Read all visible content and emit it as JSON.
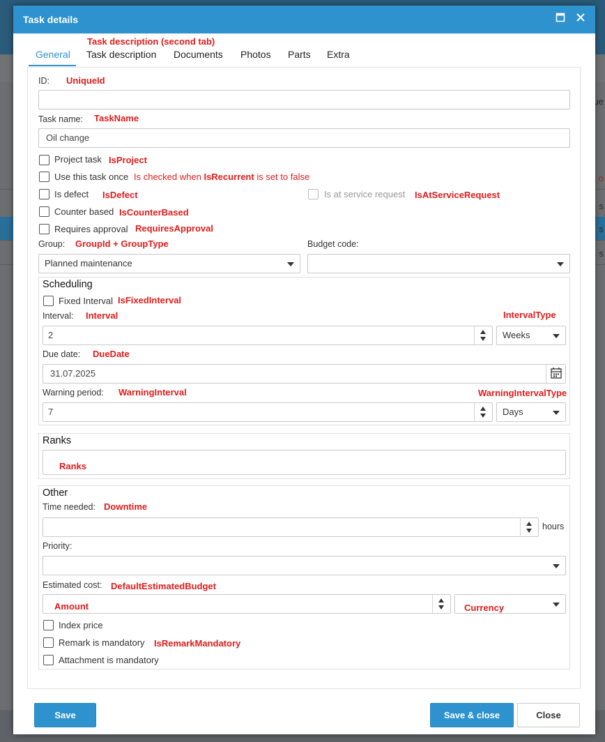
{
  "dialog": {
    "title": "Task details"
  },
  "tabs": [
    {
      "label": "General"
    },
    {
      "label": "Task description"
    },
    {
      "label": "Documents"
    },
    {
      "label": "Photos"
    },
    {
      "label": "Parts"
    },
    {
      "label": "Extra"
    }
  ],
  "annotations": {
    "task_description_tab": "Task description (second tab)",
    "unique_id": "UniqueId",
    "task_name": "TaskName",
    "is_project": "IsProject",
    "is_recurrent_pre": "Is checked when ",
    "is_recurrent_bold": "IsRecurrent",
    "is_recurrent_post": " is set to false",
    "is_defect": "IsDefect",
    "is_at_service_request": "IsAtServiceRequest",
    "is_counter_based": "IsCounterBased",
    "requires_approval": "RequiresApproval",
    "group": "GroupId + GroupType",
    "is_fixed_interval": "IsFixedInterval",
    "interval": "Interval",
    "interval_type": "IntervalType",
    "due_date": "DueDate",
    "warning_interval": "WarningInterval",
    "warning_interval_type": "WarningIntervalType",
    "ranks": "Ranks",
    "downtime": "Downtime",
    "default_estimated_budget": "DefaultEstimatedBudget",
    "amount": "Amount",
    "currency": "Currency",
    "is_remark_mandatory": "IsRemarkMandatory"
  },
  "general": {
    "id_label": "ID:",
    "id_value": "",
    "task_name_label": "Task name:",
    "task_name_value": "Oil change",
    "project_task_label": "Project task",
    "use_once_label": "Use this task once",
    "is_defect_label": "Is defect",
    "service_request_label": "Is at service request",
    "counter_based_label": "Counter based",
    "requires_approval_label": "Requires approval",
    "group_label": "Group:",
    "group_value": "Planned maintenance",
    "budget_code_label": "Budget code:",
    "budget_code_value": ""
  },
  "scheduling": {
    "title": "Scheduling",
    "fixed_interval_label": "Fixed Interval",
    "interval_label": "Interval:",
    "interval_value": "2",
    "interval_type_value": "Weeks",
    "due_date_label": "Due date:",
    "due_date_value": "31.07.2025",
    "warning_period_label": "Warning period:",
    "warning_value": "7",
    "warning_type_value": "Days"
  },
  "ranks": {
    "title": "Ranks"
  },
  "other": {
    "title": "Other",
    "time_needed_label": "Time needed:",
    "time_needed_value": "",
    "hours_unit": "hours",
    "priority_label": "Priority:",
    "priority_value": "",
    "estimated_cost_label": "Estimated cost:",
    "index_price_label": "Index price",
    "remark_mandatory_label": "Remark is mandatory",
    "attachment_mandatory_label": "Attachment is mandatory"
  },
  "footer": {
    "save": "Save",
    "save_close": "Save & close",
    "close": "Close"
  },
  "background": {
    "col_header_fragment": "Due",
    "row_fragment_red": "s o",
    "row_fragment": "s"
  },
  "colors": {
    "accent": "#2d92cd",
    "annotation": "#e11b1b"
  }
}
